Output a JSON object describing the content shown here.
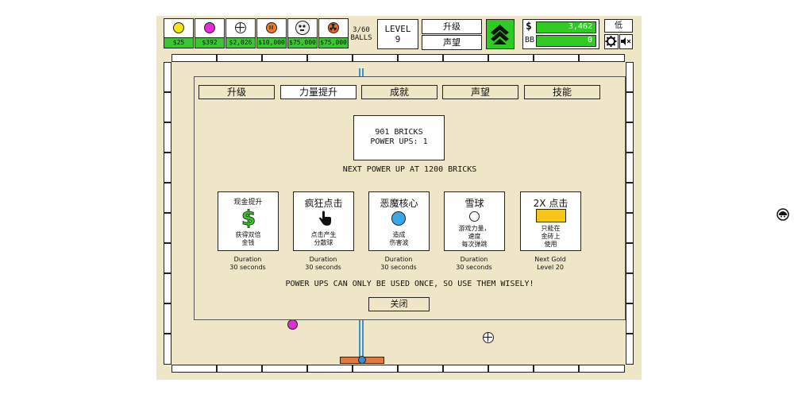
{
  "header": {
    "balls": [
      {
        "icon": "yellow-ball-icon",
        "price": "$25"
      },
      {
        "icon": "magenta-ball-icon",
        "price": "$392"
      },
      {
        "icon": "crosshair-ball-icon",
        "price": "$2,026"
      },
      {
        "icon": "orange-ball-icon",
        "price": "$10,000"
      },
      {
        "icon": "skull-ball-icon",
        "price": "$75,000"
      },
      {
        "icon": "radioactive-ball-icon",
        "price": "$75,000"
      }
    ],
    "ball_count": "3/60",
    "ball_label": "BALLS",
    "level_label": "LEVEL",
    "level_value": "9",
    "upgrade_btn": "升级",
    "prestige_btn": "声望",
    "money_symbol": "$",
    "money_value": "3,462",
    "bb_label": "BB",
    "bb_value": "0",
    "quality_btn": "低"
  },
  "modal": {
    "tabs": [
      "升级",
      "力量提升",
      "成就",
      "声望",
      "技能"
    ],
    "bricks_line": "901 BRICKS",
    "powerups_line": "POWER UPS: 1",
    "next_powerup": "NEXT POWER UP AT 1200 BRICKS",
    "cards": [
      {
        "title": "现金提升",
        "desc": [
          "获得双倍",
          "金钱"
        ],
        "note1": "Duration",
        "note2": "30 seconds",
        "icon": "dollar-icon"
      },
      {
        "title": "疯狂点击",
        "desc": [
          "点击产生",
          "分散球"
        ],
        "note1": "Duration",
        "note2": "30 seconds",
        "icon": "hand-pointer-icon"
      },
      {
        "title": "恶魔核心",
        "desc": [
          "造成",
          "伤害波"
        ],
        "note1": "Duration",
        "note2": "30 seconds",
        "icon": "blue-core-icon"
      },
      {
        "title": "雪球",
        "desc": [
          "游戏力量，",
          "速度",
          "每次弹跳"
        ],
        "note1": "Duration",
        "note2": "30 seconds",
        "icon": "snowball-icon"
      },
      {
        "title": "2X 点击",
        "desc": [
          "只能在",
          "金砖上",
          "使用"
        ],
        "note1": "Next Gold",
        "note2": "Level 20",
        "icon": "gold-brick-icon"
      }
    ],
    "warning": "POWER UPS CAN ONLY BE USED ONCE, SO USE THEM WISELY!",
    "close_btn": "关闭"
  },
  "colors": {
    "play_bg": "#efe6c8",
    "price_green": "#38c830",
    "accent_green": "#2ecc22",
    "core_blue": "#3aa7e8",
    "gold": "#f5c518",
    "magenta": "#e52ad7"
  }
}
